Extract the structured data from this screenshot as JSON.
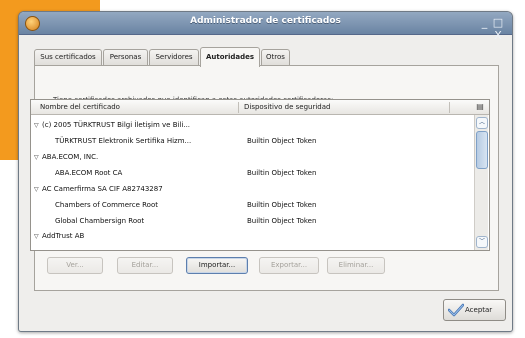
{
  "window": {
    "title": "Administrador de certificados",
    "minimize_label": "_",
    "close_label": "□ X"
  },
  "tabs": [
    {
      "label": "Sus certificados",
      "active": false
    },
    {
      "label": "Personas",
      "active": false
    },
    {
      "label": "Servidores",
      "active": false
    },
    {
      "label": "Autoridades",
      "active": true
    },
    {
      "label": "Otros",
      "active": false
    }
  ],
  "pane": {
    "description": "Tiene certificados archivados que identifican a estas autoridades certificadoras:"
  },
  "table": {
    "columns": [
      "Nombre del certificado",
      "Dispositivo de seguridad"
    ],
    "column_picker_icon": "column-picker-icon",
    "rows": [
      {
        "type": "group",
        "name": "(c) 2005 TÜRKTRUST Bilgi İletişim ve Bili...",
        "device": ""
      },
      {
        "type": "cert",
        "name": "TÜRKTRUST Elektronik Sertifika Hizm...",
        "device": "Builtin Object Token"
      },
      {
        "type": "group",
        "name": "ABA.ECOM, INC.",
        "device": ""
      },
      {
        "type": "cert",
        "name": "ABA.ECOM Root CA",
        "device": "Builtin Object Token"
      },
      {
        "type": "group",
        "name": "AC Camerfirma SA CIF A82743287",
        "device": ""
      },
      {
        "type": "cert",
        "name": "Chambers of Commerce Root",
        "device": "Builtin Object Token"
      },
      {
        "type": "cert",
        "name": "Global Chambersign Root",
        "device": "Builtin Object Token"
      },
      {
        "type": "group",
        "name": "AddTrust AB",
        "device": ""
      }
    ]
  },
  "actions": {
    "view": "Ver...",
    "edit": "Editar...",
    "import": "Importar...",
    "export": "Exportar...",
    "delete": "Eliminar..."
  },
  "ok_button": {
    "label": "Aceptar",
    "icon": "check-ok-icon"
  },
  "colors": {
    "accent": "#f39a1e",
    "titlebar": "#6a84a3",
    "window_bg": "#efeeec"
  }
}
